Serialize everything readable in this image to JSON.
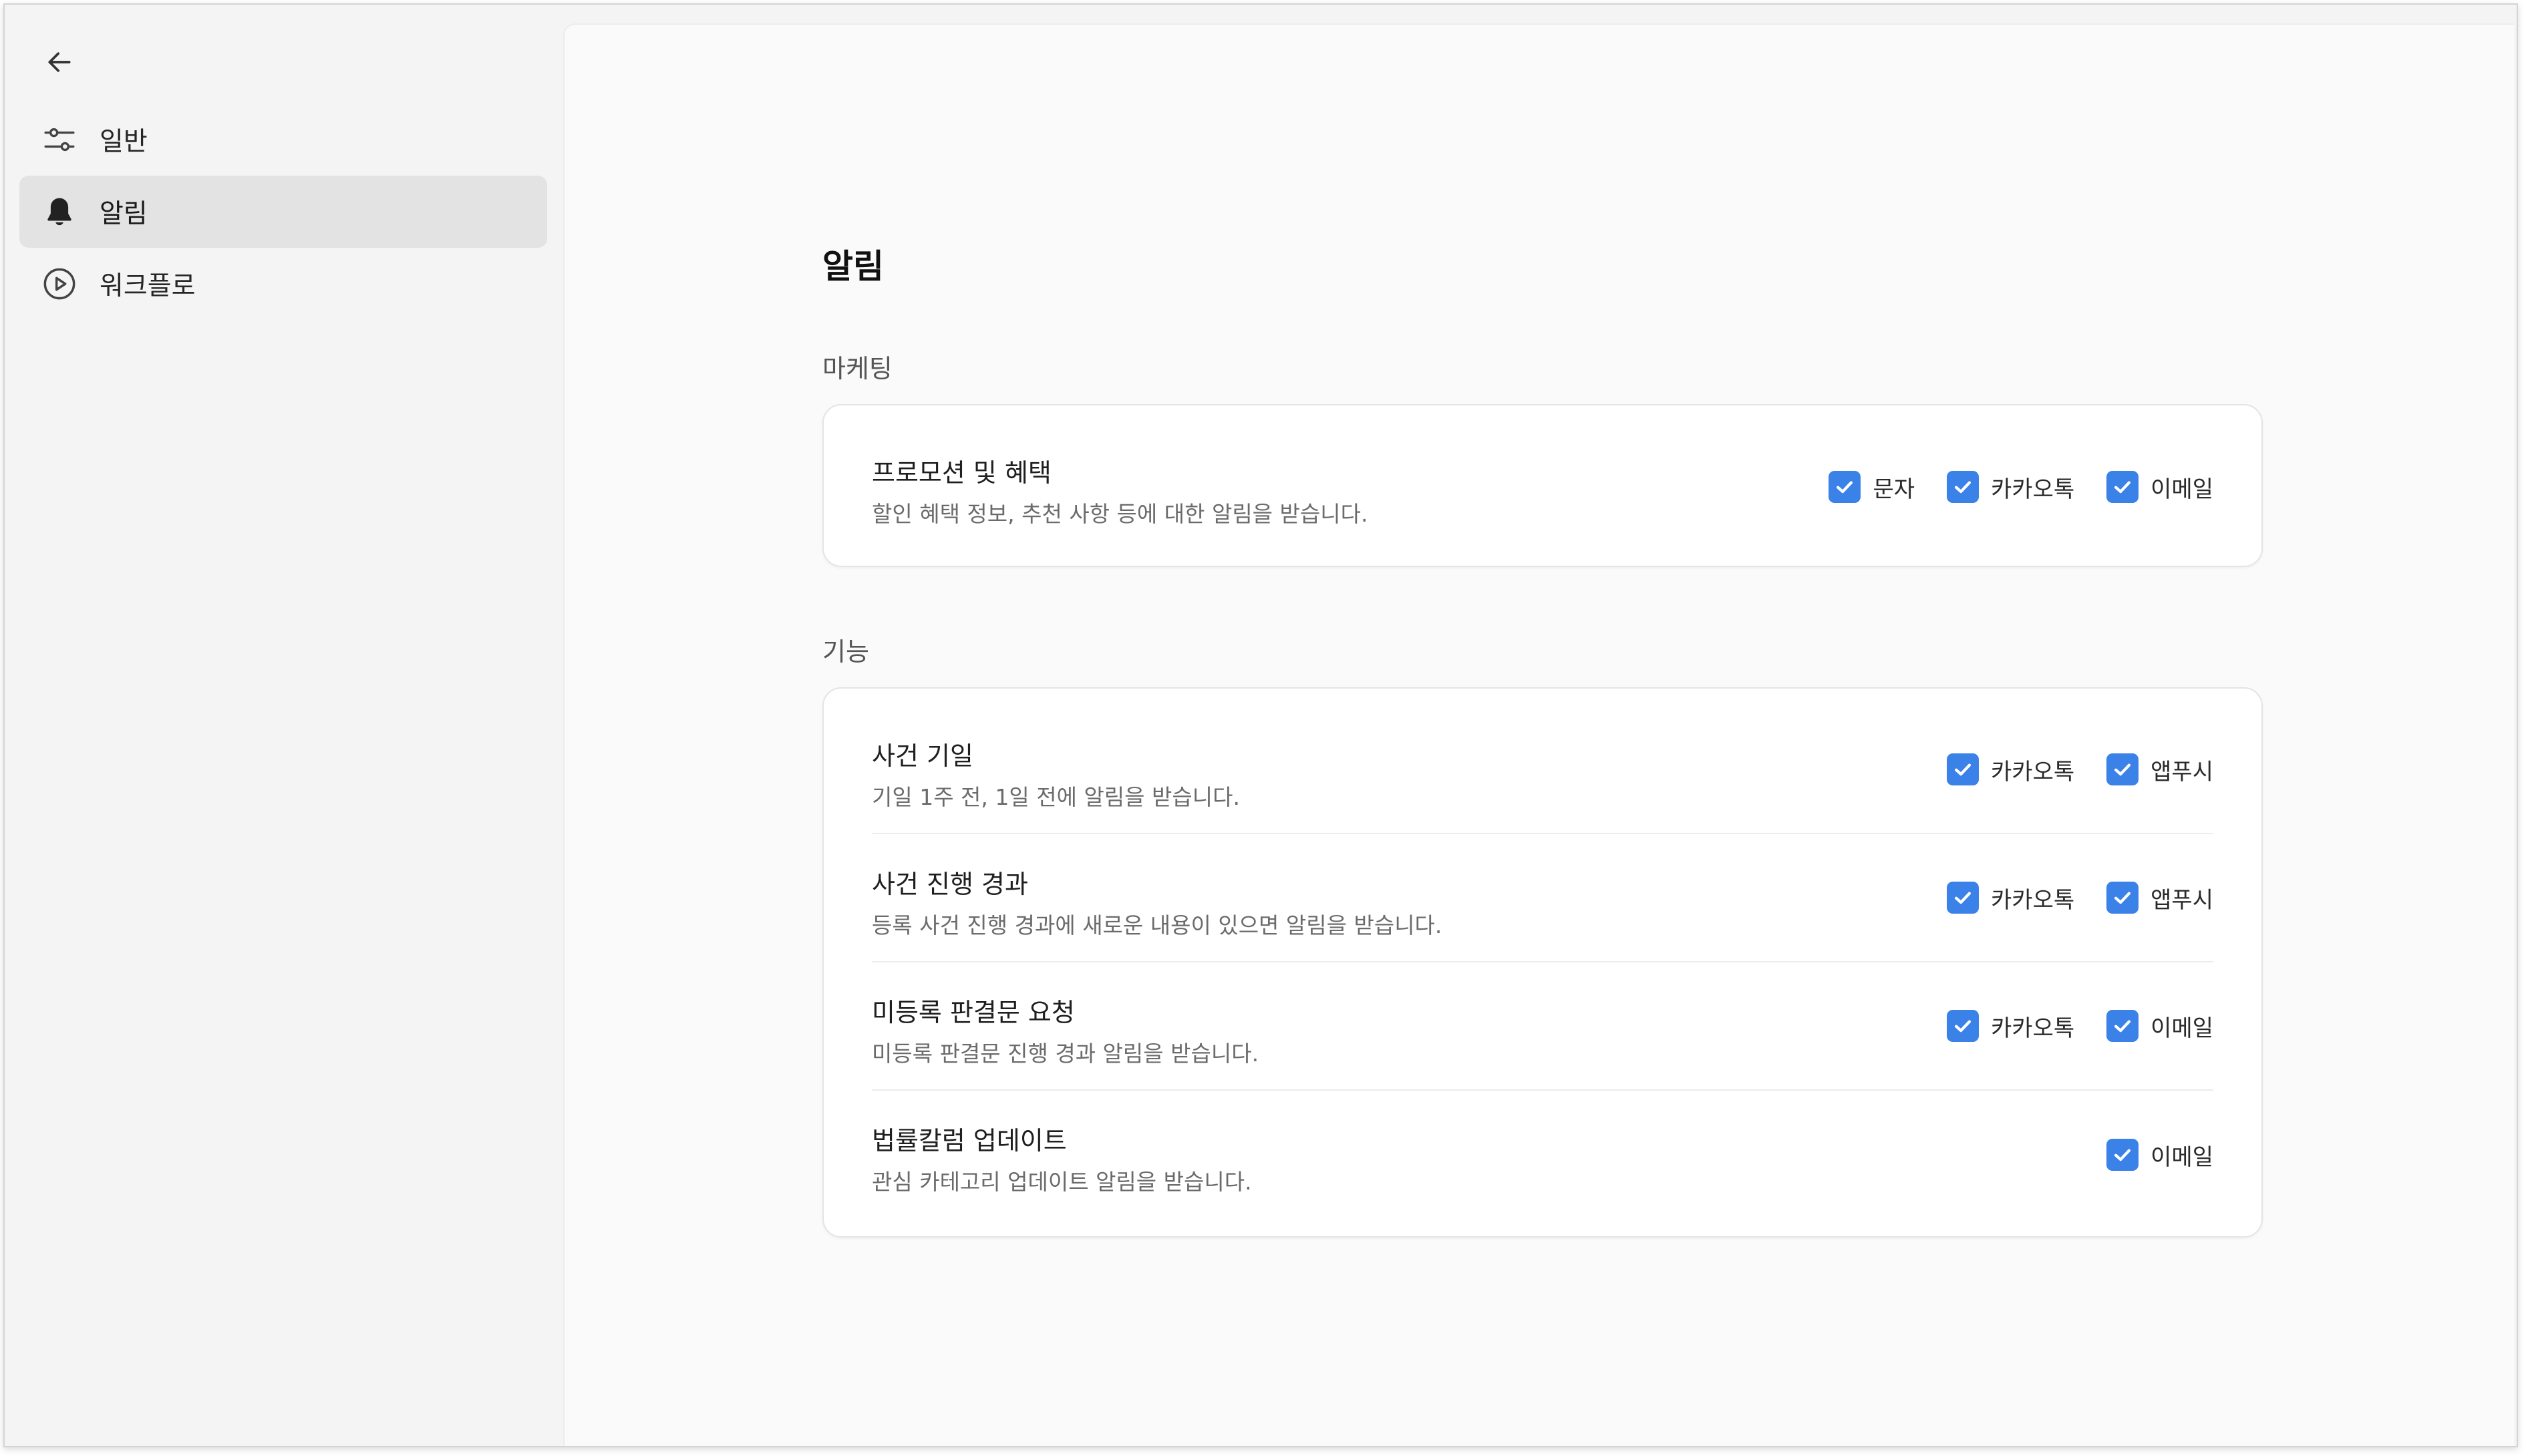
{
  "sidebar": {
    "items": [
      {
        "label": "일반",
        "icon": "sliders-icon"
      },
      {
        "label": "알림",
        "icon": "bell-icon"
      },
      {
        "label": "워크플로",
        "icon": "play-circle-icon"
      }
    ]
  },
  "main": {
    "title": "알림",
    "sections": [
      {
        "label": "마케팅",
        "rows": [
          {
            "title": "프로모션 및 혜택",
            "desc": "할인 혜택 정보, 추천 사항 등에 대한 알림을 받습니다.",
            "options": [
              {
                "label": "문자",
                "checked": true
              },
              {
                "label": "카카오톡",
                "checked": true
              },
              {
                "label": "이메일",
                "checked": true
              }
            ]
          }
        ]
      },
      {
        "label": "기능",
        "rows": [
          {
            "title": "사건 기일",
            "desc": "기일 1주 전, 1일 전에 알림을 받습니다.",
            "options": [
              {
                "label": "카카오톡",
                "checked": true
              },
              {
                "label": "앱푸시",
                "checked": true
              }
            ]
          },
          {
            "title": "사건 진행 경과",
            "desc": "등록 사건 진행 경과에 새로운 내용이 있으면 알림을 받습니다.",
            "options": [
              {
                "label": "카카오톡",
                "checked": true
              },
              {
                "label": "앱푸시",
                "checked": true
              }
            ]
          },
          {
            "title": "미등록 판결문 요청",
            "desc": "미등록 판결문 진행 경과 알림을 받습니다.",
            "options": [
              {
                "label": "카카오톡",
                "checked": true
              },
              {
                "label": "이메일",
                "checked": true
              }
            ]
          },
          {
            "title": "법률칼럼 업데이트",
            "desc": "관심 카테고리 업데이트 알림을 받습니다.",
            "options": [
              {
                "label": "이메일",
                "checked": true
              }
            ]
          }
        ]
      }
    ]
  },
  "colors": {
    "accent": "#3b82e8",
    "active_nav_bg": "#e3e3e3",
    "sidebar_bg": "#f4f4f4",
    "panel_bg": "#fafafa"
  }
}
